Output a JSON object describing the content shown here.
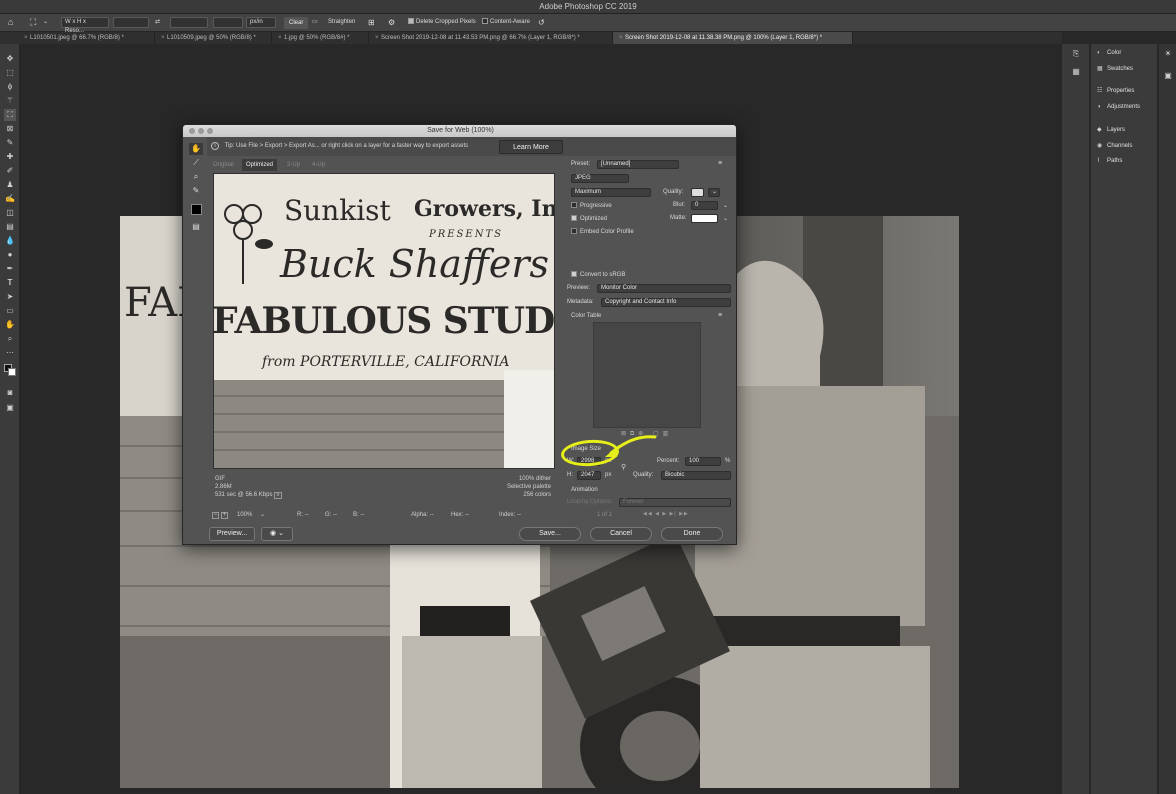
{
  "app": {
    "title": "Adobe Photoshop CC 2019"
  },
  "options_bar": {
    "ratio_select": "W x H x Reso...",
    "unit_select": "px/in",
    "clear_button": "Clear",
    "straighten_label": "Straighten",
    "delete_cropped_label": "Delete Cropped Pixels",
    "delete_cropped_checked": true,
    "content_aware_label": "Content-Aware",
    "content_aware_checked": false
  },
  "document_tabs": [
    "L1010501.jpeg @ 66.7% (RGB/8) *",
    "L1010509.jpeg @ 50% (RGB/8) *",
    "1.jpg @ 50% (RGB/8#) *",
    "Screen Shot 2019-12-08 at 11.43.53 PM.png @ 66.7% (Layer 1, RGB/8*) *",
    "Screen Shot 2019-12-08 at 11.38.38 PM.png @ 100% (Layer 1, RGB/8*) *"
  ],
  "active_tab_index": 4,
  "panels": [
    {
      "icon": "color-wheel-icon",
      "label": "Color"
    },
    {
      "icon": "swatches-icon",
      "label": "Swatches"
    },
    {
      "icon": "properties-icon",
      "label": "Properties"
    },
    {
      "icon": "adjustments-icon",
      "label": "Adjustments"
    },
    {
      "icon": "layers-icon",
      "label": "Layers"
    },
    {
      "icon": "channels-icon",
      "label": "Channels"
    },
    {
      "icon": "paths-icon",
      "label": "Paths"
    }
  ],
  "dialog": {
    "title": "Save for Web (100%)",
    "tip": "Tip: Use File > Export > Export As...  or right click on a layer for a faster way to export assets",
    "learn_more": "Learn More",
    "view_tabs": [
      "Original",
      "Optimized",
      "2-Up",
      "4-Up"
    ],
    "active_view_tab": 1,
    "preview_sign": {
      "line1a": "Sunkist",
      "line1b": "Growers, Inc",
      "line2": "PRESENTS",
      "line3": "Buck Shaffers",
      "line4": "FABULOUS STUDIO BA",
      "line5": "from PORTERVILLE, CALIFORNIA"
    },
    "info_left": [
      "GIF",
      "2.86M",
      "531 sec @ 56.6 Kbps"
    ],
    "info_right": [
      "100% dither",
      "Selective palette",
      "256 colors"
    ],
    "status": {
      "zoom": "100%",
      "r": "R: --",
      "g": "G: --",
      "b": "B: --",
      "alpha": "Alpha: --",
      "hex": "Hex: --",
      "index": "Index: --"
    },
    "settings": {
      "preset_label": "Preset:",
      "preset_value": "[Unnamed]",
      "format": "JPEG",
      "quality_preset": "Maximum",
      "quality_label": "Quality:",
      "progressive_label": "Progressive",
      "progressive_checked": false,
      "blur_label": "Blur:",
      "blur_value": "0",
      "optimized_label": "Optimized",
      "optimized_checked": true,
      "matte_label": "Matte:",
      "embed_label": "Embed Color Profile",
      "embed_checked": false,
      "srgb_label": "Convert to sRGB",
      "srgb_checked": true,
      "preview_label": "Preview:",
      "preview_value": "Monitor Color",
      "metadata_label": "Metadata:",
      "metadata_value": "Copyright and Contact Info",
      "color_table_label": "Color Table",
      "image_size_label": "Image Size",
      "w_label": "W:",
      "w_value": "2998",
      "h_label": "H:",
      "h_value": "2047",
      "px": "px",
      "percent_label": "Percent:",
      "percent_value": "100",
      "percent_sign": "%",
      "resample_label": "Quality:",
      "resample_value": "Bicubic",
      "animation_label": "Animation",
      "looping_label": "Looping Options:",
      "looping_value": "Forever",
      "frame_counter": "1 of 1"
    },
    "buttons": {
      "preview": "Preview...",
      "save": "Save...",
      "cancel": "Cancel",
      "done": "Done"
    }
  },
  "colors": {
    "annotation": "#e6ef1a",
    "dialog_bg": "#535353",
    "workspace": "#282828"
  }
}
